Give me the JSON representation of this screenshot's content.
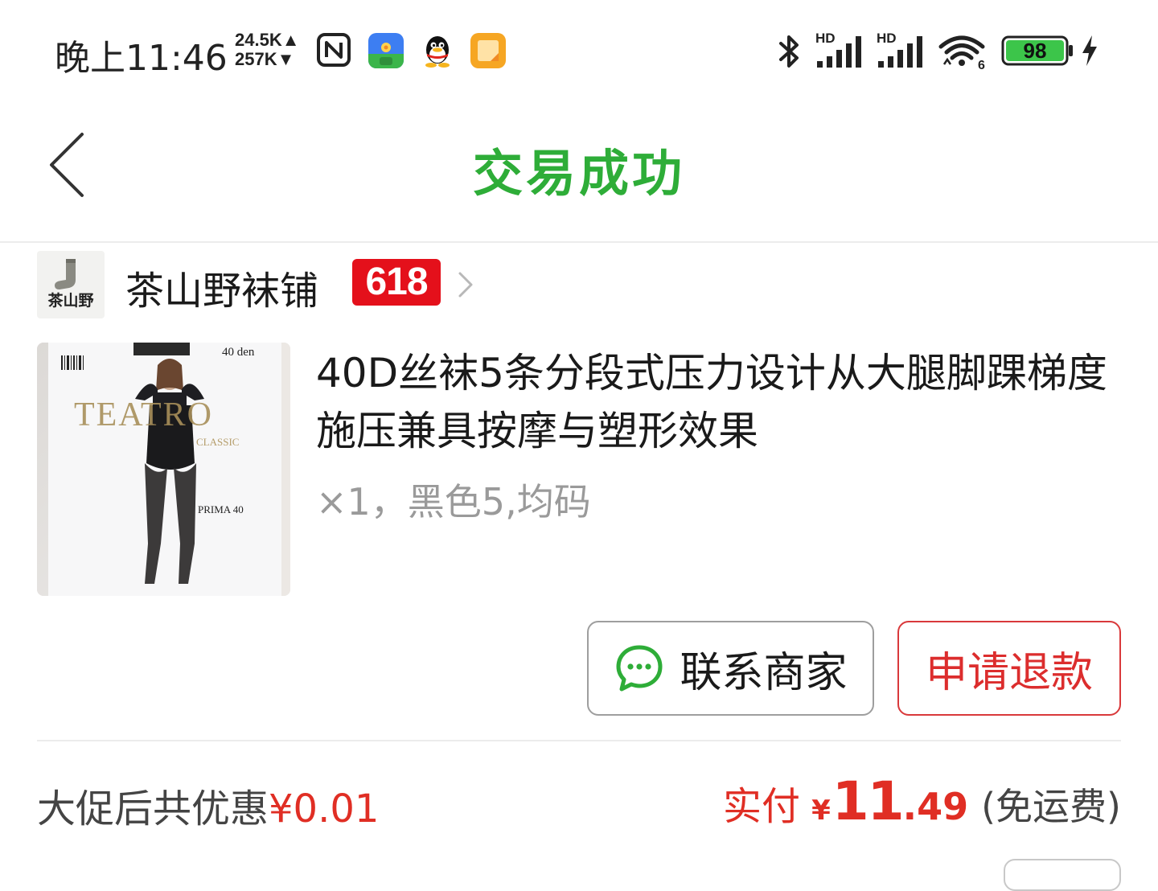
{
  "status_bar": {
    "time": "晚上11:46",
    "upload_speed": "24.5K▲",
    "download_speed": "257K▼",
    "sim1_label": "HD",
    "sim2_label": "HD",
    "wifi_label": "6",
    "battery_level": "98",
    "icons": [
      "nfc-icon",
      "app-launcher-icon",
      "qq-icon",
      "notes-app-icon",
      "bluetooth-icon",
      "signal-icon",
      "wifi-icon",
      "battery-icon",
      "charging-icon"
    ]
  },
  "nav": {
    "title": "交易成功",
    "title_color": "#2ead38"
  },
  "shop": {
    "logo_text": "茶山野",
    "name": "茶山野袜铺",
    "badge": "618",
    "badge_color": "#e4101b"
  },
  "product": {
    "title": "40D丝袜5条分段式压力设计从大腿脚踝梯度施压兼具按摩与塑形效果",
    "spec": "×1，黑色5,均码",
    "image_text": {
      "brand": "TEATRO",
      "sub": "CLASSIC",
      "den": "40 den",
      "model": "PRIMA 40"
    }
  },
  "actions": {
    "contact_label": "联系商家",
    "refund_label": "申请退款",
    "accent_color": "#dc2d2d",
    "chat_icon_color": "#2ead38"
  },
  "summary": {
    "discount_label": "大促后共优惠",
    "discount_value": "¥0.01",
    "paid_label": "实付",
    "currency": "¥",
    "paid_int": "11",
    "paid_dec": ".49",
    "shipping": "(免运费)"
  }
}
